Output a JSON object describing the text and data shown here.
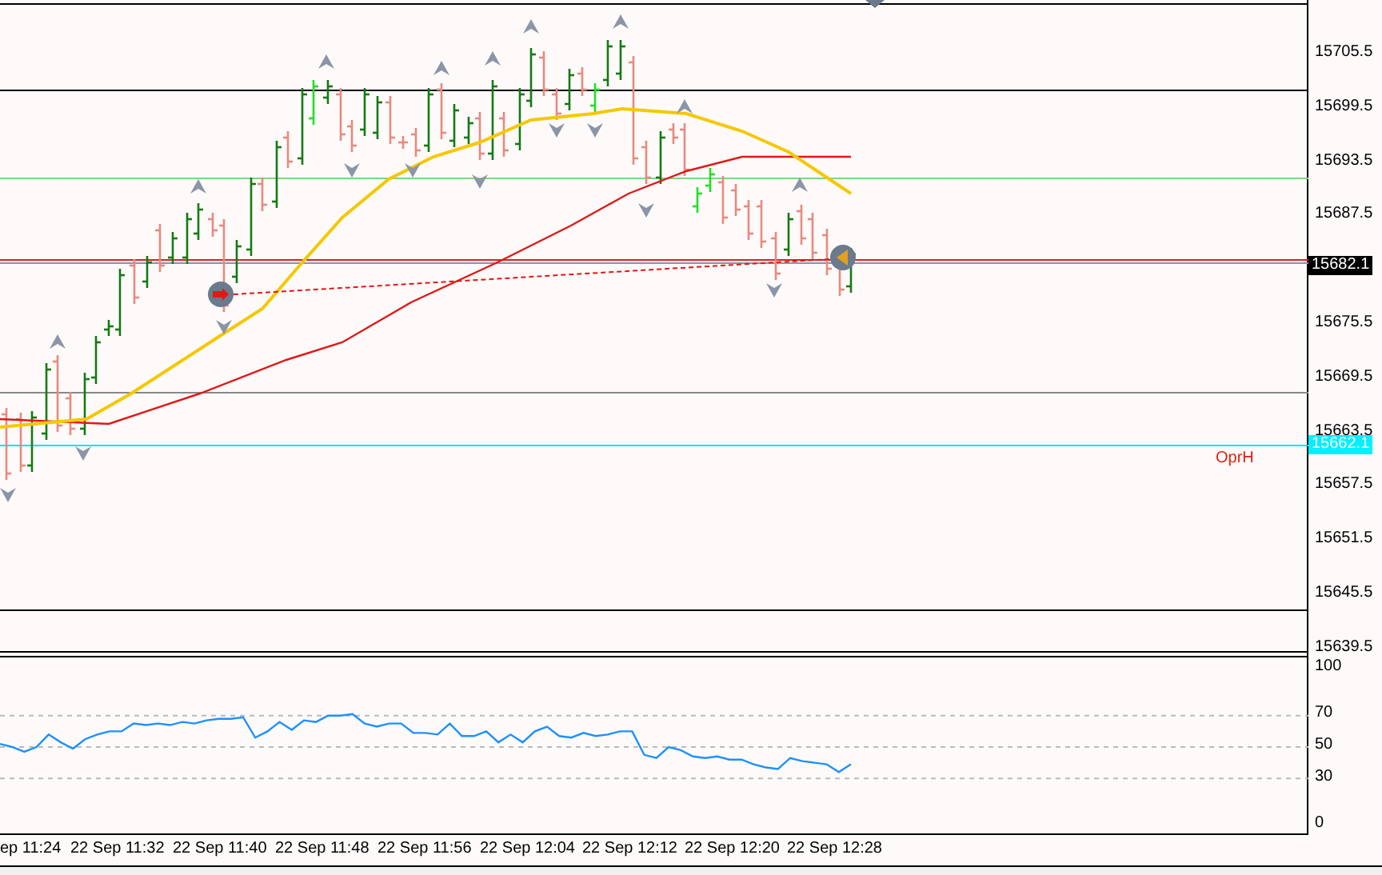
{
  "price_axis": {
    "labels": [
      "15705.5",
      "15699.5",
      "15693.5",
      "15687.5",
      "15675.5",
      "15669.5",
      "15663.5",
      "15657.5",
      "15651.5",
      "15645.5",
      "15639.5"
    ],
    "current_price": "15682.1",
    "level_price": "15662.1"
  },
  "chart": {
    "level_label": "OprH"
  },
  "indicator_axis": {
    "labels": [
      "100",
      "70",
      "50",
      "30",
      "0"
    ]
  },
  "time_axis": {
    "labels": [
      "ep 11:24",
      "22 Sep 11:32",
      "22 Sep 11:40",
      "22 Sep 11:48",
      "22 Sep 11:56",
      "22 Sep 12:04",
      "22 Sep 12:12",
      "22 Sep 12:20",
      "22 Sep 12:28"
    ]
  }
}
